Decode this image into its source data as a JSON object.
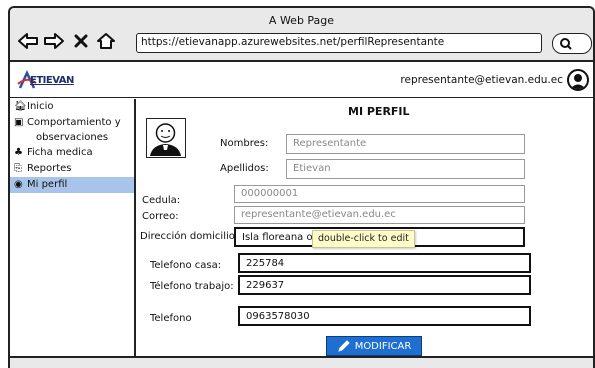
{
  "window": {
    "title": "A Web Page",
    "url": "https://etievanapp.azurewebsites.net/perfilRepresentante"
  },
  "header": {
    "logo_text": "ETIEVAN",
    "user_email": "representante@etievan.edu.ec"
  },
  "sidebar": {
    "items": [
      {
        "label": "Inicio",
        "icon": "home-icon",
        "glyph": "🏠︎"
      },
      {
        "label": "Comportamiento y",
        "sub": "observaciones",
        "icon": "notebook-icon",
        "glyph": "▣"
      },
      {
        "label": "Ficha medica",
        "icon": "medical-icon",
        "glyph": "♣"
      },
      {
        "label": "Reportes",
        "icon": "report-icon",
        "glyph": "⎘"
      },
      {
        "label": "Mi perfil",
        "icon": "user-circle-icon",
        "glyph": "◉",
        "active": true
      }
    ]
  },
  "profile": {
    "title": "MI PERFIL",
    "nombres_label": "Nombres:",
    "nombres_value": "Representante",
    "apellidos_label": "Apellidos:",
    "apellidos_value": "Etievan",
    "cedula_label": "Cedula:",
    "cedula_value": "000000001",
    "correo_label": "Correo:",
    "correo_value": "representante@etievan.edu.ec",
    "direccion_label": "Dirección domicilio:",
    "direccion_value": "Isla floreana oe",
    "tel_casa_label": "Telefono casa:",
    "tel_casa_value": "225784",
    "tel_trabajo_label": "Télefono trabajo:",
    "tel_trabajo_value": "229637",
    "telefono_label": "Telefono",
    "telefono_value": "0963578030",
    "tooltip": "double-click to edit",
    "modify_label": "MODIFICAR"
  },
  "colors": {
    "accent": "#1f6fd1",
    "active_nav": "#a9c4ea",
    "tooltip_bg": "#fefcc8"
  }
}
